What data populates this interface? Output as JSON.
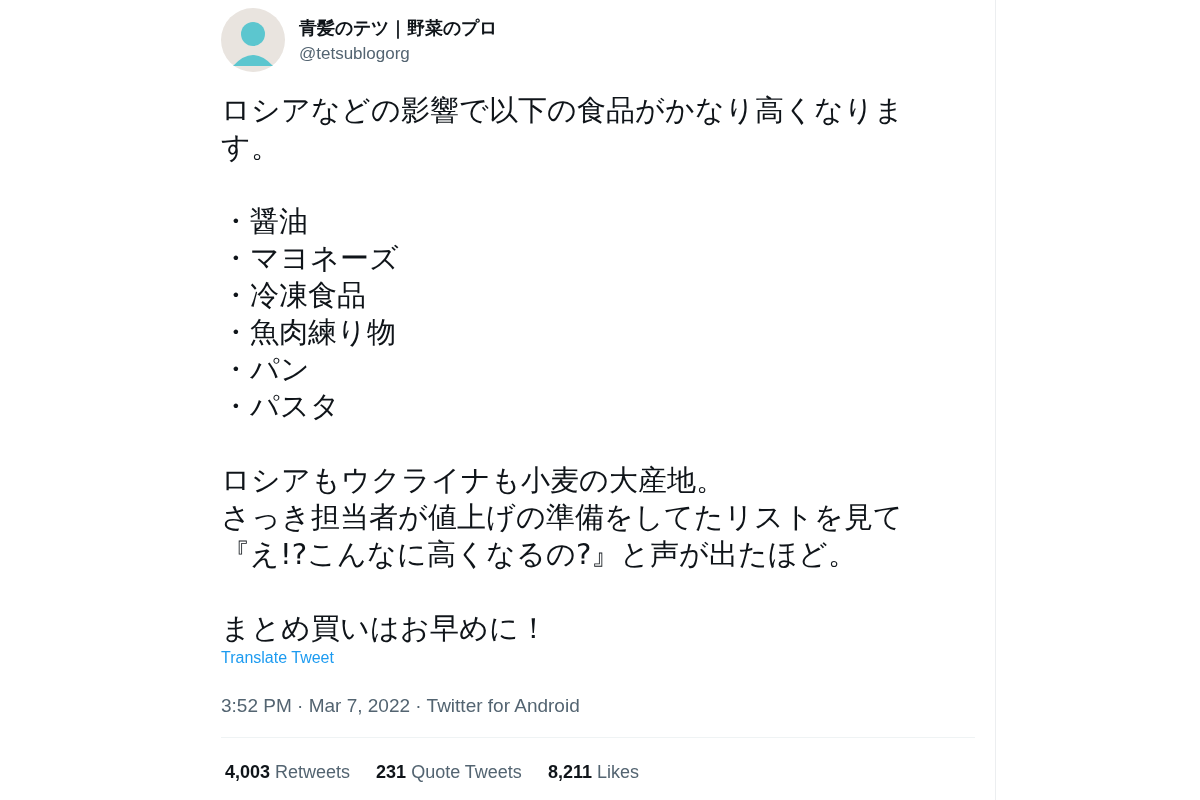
{
  "tweet": {
    "author": {
      "name": "青髪のテツ｜野菜のプロ",
      "handle": "@tetsublogorg"
    },
    "body": [
      {
        "kind": "text",
        "text": "ロシアなどの影響で以下の食品がかなり高くなります。"
      },
      {
        "kind": "list",
        "items": [
          "・醤油",
          "・マヨネーズ",
          "・冷凍食品",
          "・魚肉練り物",
          "・パン",
          "・パスタ"
        ]
      },
      {
        "kind": "list",
        "items": [
          "ロシアもウクライナも小麦の大産地。",
          "さっき担当者が値上げの準備をしてたリストを見て",
          "『え!?こんなに高くなるの?』と声が出たほど。"
        ]
      },
      {
        "kind": "text",
        "text": "まとめ買いはお早めに！"
      }
    ],
    "translate_link": "Translate Tweet",
    "meta": "3:52 PM · Mar 7, 2022 · Twitter for Android",
    "stats": [
      {
        "count": "4,003",
        "label": "Retweets"
      },
      {
        "count": "231",
        "label": "Quote Tweets"
      },
      {
        "count": "8,211",
        "label": "Likes"
      }
    ]
  }
}
